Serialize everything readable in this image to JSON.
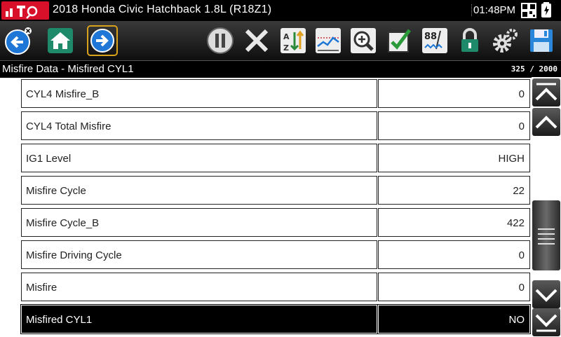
{
  "header": {
    "vehicle": "2018 Honda Civic Hatchback 1.8L (R18Z1)",
    "time": "01:48PM"
  },
  "toolbar": {
    "buttons": [
      "back-icon",
      "home-icon",
      "forward-icon",
      "pause-icon",
      "close-icon",
      "sort-icon",
      "graph-icon",
      "zoom-icon",
      "check-icon",
      "gauge-icon",
      "lock-icon",
      "gear-icon",
      "save-icon"
    ]
  },
  "screen": {
    "title": "Misfire Data - Misfired CYL1",
    "counter": "325 / 2000"
  },
  "rows": [
    {
      "name": "CYL4 Misfire_B",
      "value": "0"
    },
    {
      "name": "CYL4 Total Misfire",
      "value": "0"
    },
    {
      "name": "IG1 Level",
      "value": "HIGH"
    },
    {
      "name": "Misfire Cycle",
      "value": "22"
    },
    {
      "name": "Misfire Cycle_B",
      "value": "422"
    },
    {
      "name": "Misfire Driving Cycle",
      "value": "0"
    },
    {
      "name": "Misfire",
      "value": "0"
    },
    {
      "name": "Misfired CYL1",
      "value": "NO"
    }
  ],
  "colors": {
    "accent": "#d9a21b",
    "brand": "#d8102a",
    "button_blue": "#1e77d6"
  }
}
